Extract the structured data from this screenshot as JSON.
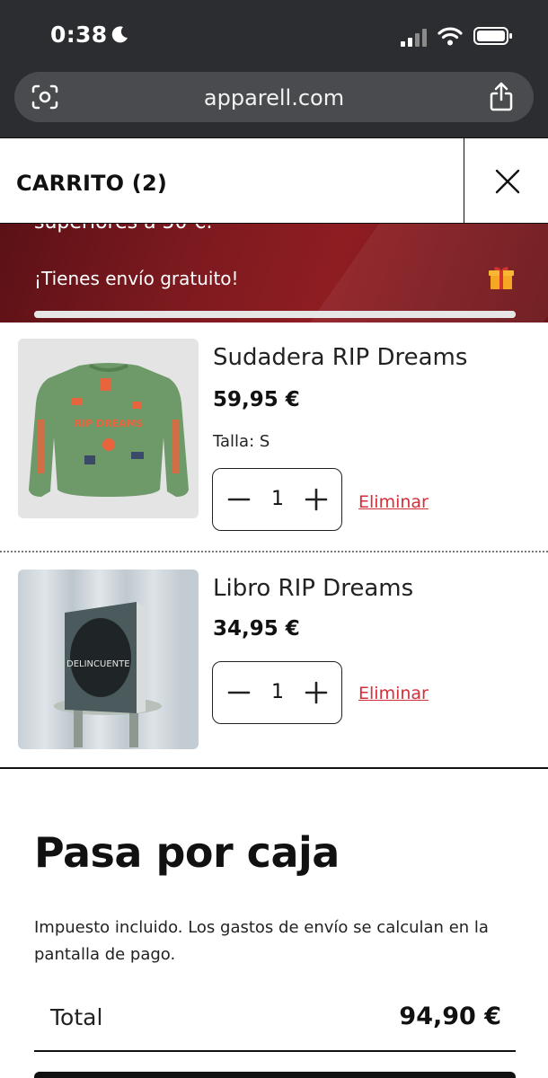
{
  "status_bar": {
    "time": "0:38"
  },
  "browser": {
    "url": "apparell.com"
  },
  "cart": {
    "title": "CARRITO (2)",
    "banner": {
      "cut_text": "superiores a 50 €.",
      "message": "¡Tienes envío gratuito!",
      "progress": 1.0
    },
    "items": [
      {
        "name": "Sudadera RIP Dreams",
        "price": "59,95 €",
        "variant": "Talla: S",
        "quantity": "1",
        "remove_label": "Eliminar"
      },
      {
        "name": "Libro RIP Dreams",
        "price": "34,95 €",
        "quantity": "1",
        "remove_label": "Eliminar"
      }
    ],
    "checkout": {
      "title": "Pasa por caja",
      "note": "Impuesto incluido. Los gastos de envío se calculan en la pantalla de pago.",
      "total_label": "Total",
      "total_value": "94,90 €"
    }
  },
  "colors": {
    "banner": "#7d1a1f",
    "remove_link": "#d32f3a",
    "chrome": "#2b2d30"
  }
}
